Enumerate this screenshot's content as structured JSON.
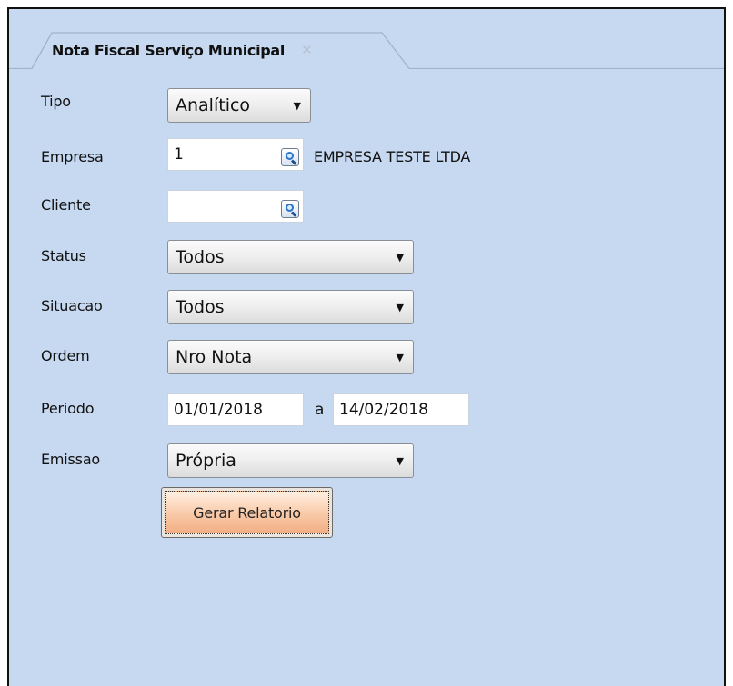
{
  "tab": {
    "title": "Nota Fiscal Serviço Municipal",
    "close_glyph": "✕"
  },
  "form": {
    "tipo": {
      "label": "Tipo",
      "value": "Analítico"
    },
    "empresa": {
      "label": "Empresa",
      "value": "1",
      "name": "EMPRESA TESTE LTDA"
    },
    "cliente": {
      "label": "Cliente",
      "value": ""
    },
    "status": {
      "label": "Status",
      "value": "Todos"
    },
    "situacao": {
      "label": "Situacao",
      "value": "Todos"
    },
    "ordem": {
      "label": "Ordem",
      "value": "Nro Nota"
    },
    "periodo": {
      "label": "Periodo",
      "from": "01/01/2018",
      "separator": "a",
      "to": "14/02/2018"
    },
    "emissao": {
      "label": "Emissao",
      "value": "Própria"
    }
  },
  "button": {
    "generate_label": "Gerar Relatorio"
  },
  "icons": {
    "dropdown": "dropdown-arrow-icon",
    "lookup": "magnifier-icon",
    "close": "close-icon"
  },
  "colors": {
    "panel": "#c6d9f1",
    "button": "#f9c9a7"
  }
}
